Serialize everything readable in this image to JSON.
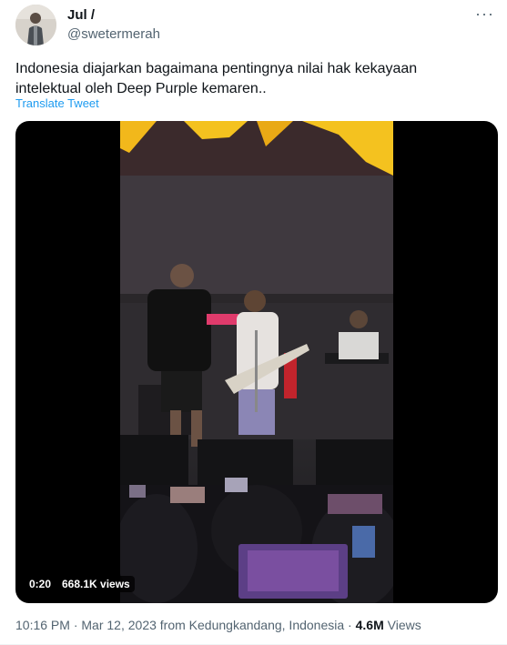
{
  "tweet": {
    "author_name": "Jul /",
    "author_handle": "@swetermerah",
    "more_icon": "more-dots-icon",
    "text": "Indonesia diajarkan bagaimana pentingnya nilai hak kekayaan intelektual oleh Deep Purple kemaren..",
    "translate_label": "Translate Tweet"
  },
  "video": {
    "duration": "0:20",
    "views": "668.1K views"
  },
  "meta": {
    "time": "10:16 PM",
    "separator": "·",
    "date": "Mar 12, 2023",
    "location": "from Kedungkandang, Indonesia",
    "view_count": "4.6M",
    "views_label": "Views"
  },
  "colors": {
    "link": "#1d9bf0",
    "secondary_text": "#536471",
    "primary_text": "#0f1419"
  }
}
